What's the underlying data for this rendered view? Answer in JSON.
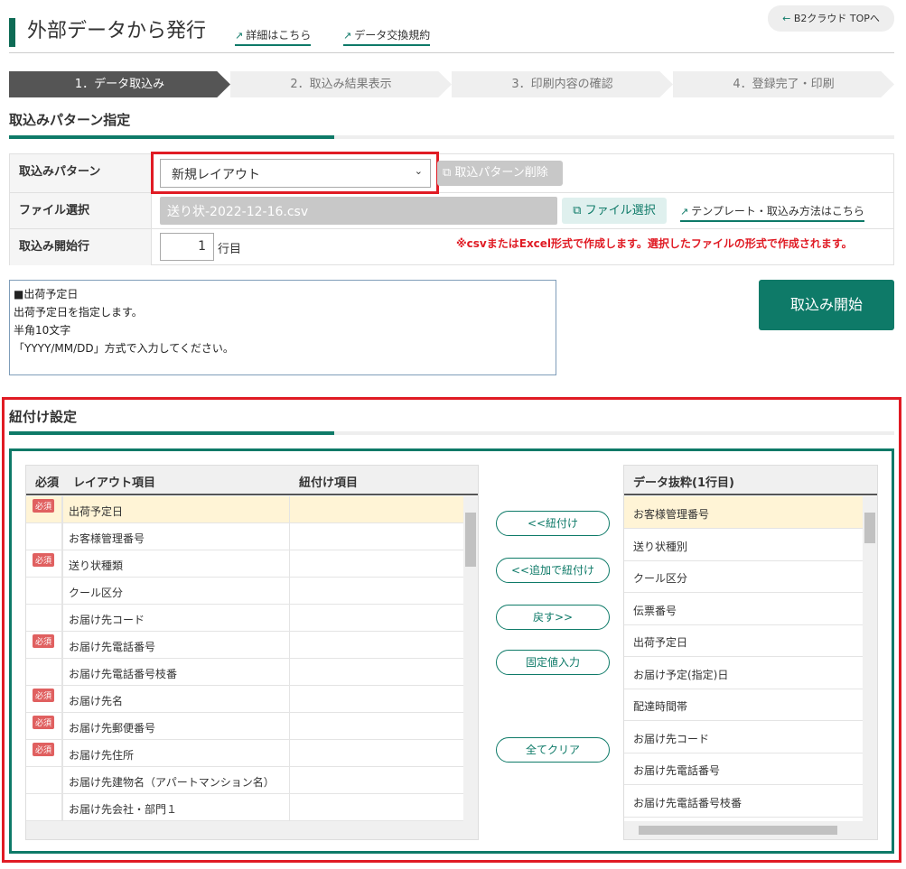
{
  "header": {
    "title": "外部データから発行",
    "links": [
      "詳細はこちら",
      "データ交換規約"
    ],
    "top_button": "B2クラウド TOPへ"
  },
  "steps": [
    "1．データ取込み",
    "2．取込み結果表示",
    "3．印刷内容の確認",
    "4．登録完了・印刷"
  ],
  "pattern_section": {
    "title": "取込みパターン指定",
    "pattern_label": "取込みパターン",
    "pattern_value": "新規レイアウト",
    "delete_button": "取込パターン削除",
    "file_label": "ファイル選択",
    "file_value": "送り状-2022-12-16.csv",
    "file_button": "ファイル選択",
    "template_link": "テンプレート・取込み方法はこちら",
    "start_row_label": "取込み開始行",
    "start_row_value": "1",
    "start_row_unit": "行目",
    "note": "※csvまたはExcel形式で作成します。選択したファイルの形式で作成されます。"
  },
  "help_text": "■出荷予定日\n出荷予定日を指定します。\n半角10文字\n「YYYY/MM/DD」方式で入力してください。",
  "start_button": "取込み開始",
  "mapping": {
    "title": "紐付け設定",
    "left_headers": [
      "必須",
      "レイアウト項目",
      "紐付け項目"
    ],
    "required_badge": "必須",
    "rows": [
      {
        "name": "出荷予定日",
        "required": true
      },
      {
        "name": "お客様管理番号",
        "required": false
      },
      {
        "name": "送り状種類",
        "required": true
      },
      {
        "name": "クール区分",
        "required": false
      },
      {
        "name": "お届け先コード",
        "required": false
      },
      {
        "name": "お届け先電話番号",
        "required": true
      },
      {
        "name": "お届け先電話番号枝番",
        "required": false
      },
      {
        "name": "お届け先名",
        "required": true
      },
      {
        "name": "お届け先郵便番号",
        "required": true
      },
      {
        "name": "お届け先住所",
        "required": true
      },
      {
        "name": "お届け先建物名（アパートマンション名）",
        "required": false
      },
      {
        "name": "お届け先会社・部門１",
        "required": false
      }
    ],
    "buttons": [
      "<<紐付け",
      "<<追加で紐付け",
      "戻す>>",
      "固定値入力",
      "全てクリア"
    ],
    "right_header": "データ抜粋(1行目)",
    "right_rows": [
      "お客様管理番号",
      "送り状種別",
      "クール区分",
      "伝票番号",
      "出荷予定日",
      "お届け予定(指定)日",
      "配達時間帯",
      "お届け先コード",
      "お届け先電話番号",
      "お届け先電話番号枝番"
    ]
  },
  "colors": {
    "brand": "#0e7a68",
    "highlight": "#e01b24"
  }
}
